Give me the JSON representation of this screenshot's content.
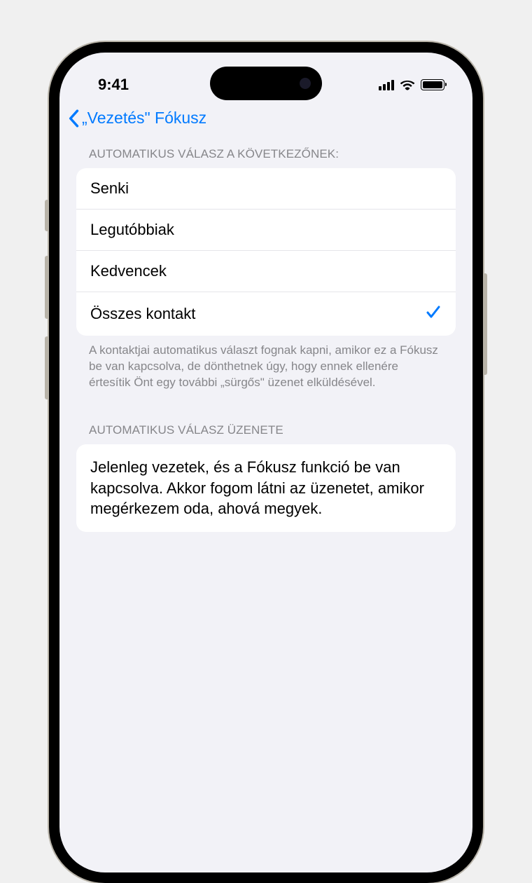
{
  "status": {
    "time": "9:41"
  },
  "nav": {
    "back_label": "„Vezetés\" Fókusz"
  },
  "section1": {
    "header": "AUTOMATIKUS VÁLASZ A KÖVETKEZŐNEK:",
    "options": [
      "Senki",
      "Legutóbbiak",
      "Kedvencek",
      "Összes kontakt"
    ],
    "footer": "A kontaktjai automatikus választ fognak kapni, amikor ez a Fókusz be van kapcsolva, de dönthetnek úgy, hogy ennek ellenére értesítik Önt egy további „sürgős\" üzenet elküldésével."
  },
  "section2": {
    "header": "AUTOMATIKUS VÁLASZ ÜZENETE",
    "message": "Jelenleg vezetek, és a Fókusz funkció be van kapcsolva. Akkor fogom látni az üzenetet, amikor megérkezem oda, ahová megyek."
  }
}
